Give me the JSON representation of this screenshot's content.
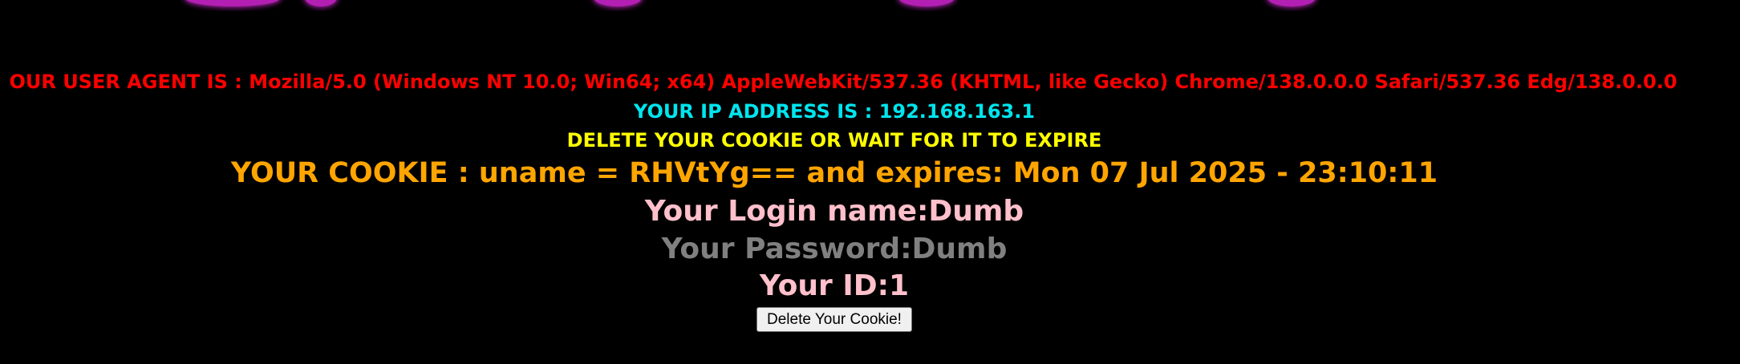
{
  "user_agent_line": "OUR USER AGENT IS : Mozilla/5.0 (Windows NT 10.0; Win64; x64) AppleWebKit/537.36 (KHTML, like Gecko) Chrome/138.0.0.0 Safari/537.36 Edg/138.0.0.0",
  "ip_line": "YOUR IP ADDRESS IS : 192.168.163.1",
  "delete_message": "DELETE YOUR COOKIE OR WAIT FOR IT TO EXPIRE",
  "cookie_line": "YOUR COOKIE : uname = RHVtYg== and expires: Mon 07 Jul 2025 - 23:10:11",
  "login_line": "Your Login name:Dumb",
  "password_line": "Your Password:Dumb",
  "id_line": "Your ID:1",
  "delete_button_label": "Delete Your Cookie!",
  "colors": {
    "background": "#000000",
    "user_agent": "#ff0000",
    "ip": "#00e5ee",
    "delete_message": "#ffff00",
    "cookie": "#ffa500",
    "login": "#ffc0cb",
    "password": "#808080",
    "id": "#ffc0cb"
  }
}
